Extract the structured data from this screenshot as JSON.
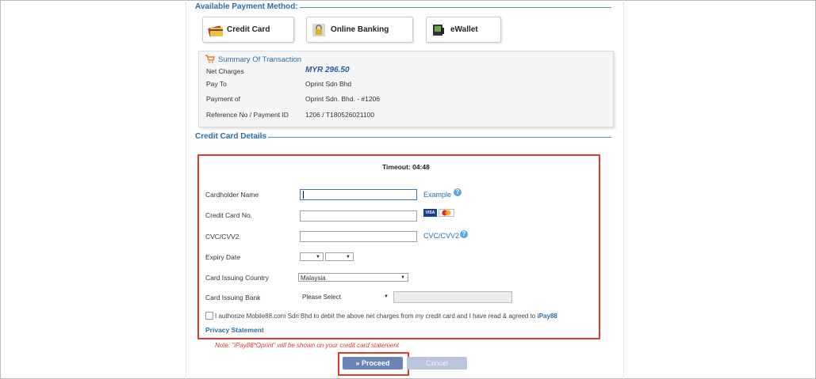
{
  "payment_methods": {
    "heading": "Available Payment Method:",
    "items": [
      {
        "label": "Credit Card",
        "icon": "credit-card-icon"
      },
      {
        "label": "Online Banking",
        "icon": "lock-icon"
      },
      {
        "label": "eWallet",
        "icon": "ewallet-icon"
      }
    ]
  },
  "summary": {
    "title": "Summary Of Transaction",
    "rows": [
      {
        "label": "Net Charges",
        "value": "MYR 296.50"
      },
      {
        "label": "Pay To",
        "value": "Oprint Sdn Bhd"
      },
      {
        "label": "Payment of",
        "value": "Oprint Sdn. Bhd. - #1206"
      },
      {
        "label": "Reference No / Payment ID",
        "value": "1206 / T180526021100"
      }
    ]
  },
  "card_details": {
    "heading": "Credit Card Details",
    "timeout_label": "Timeout: 04:48",
    "fields": {
      "cardholder_name": "Cardholder Name",
      "card_no": "Credit Card No.",
      "cvc": "CVC/CVV2",
      "expiry": "Expiry Date",
      "country": "Card Issuing Country",
      "bank": "Card Issuing Bank"
    },
    "example_link": "Example",
    "cvc_link": "CVC/CVV2",
    "country_value": "Malaysia",
    "bank_value": "Please Select",
    "authorize_text": "I authorize Mobile88.com Sdn Bhd to debit the above net charges from my credit card and I have read & agreed to",
    "ipay_link": "iPay88",
    "privacy_link": "Privacy Statement",
    "card_logos": [
      "VISA",
      "MasterCard"
    ]
  },
  "note": "Note: \"iPay88*Oprint\" will be shown on your credit card statement",
  "buttons": {
    "proceed": "» Proceed",
    "cancel": "Cancel"
  },
  "colors": {
    "accent": "#2b6ea6",
    "highlight_red": "#e13a30",
    "proceed": "#6e84b8"
  }
}
